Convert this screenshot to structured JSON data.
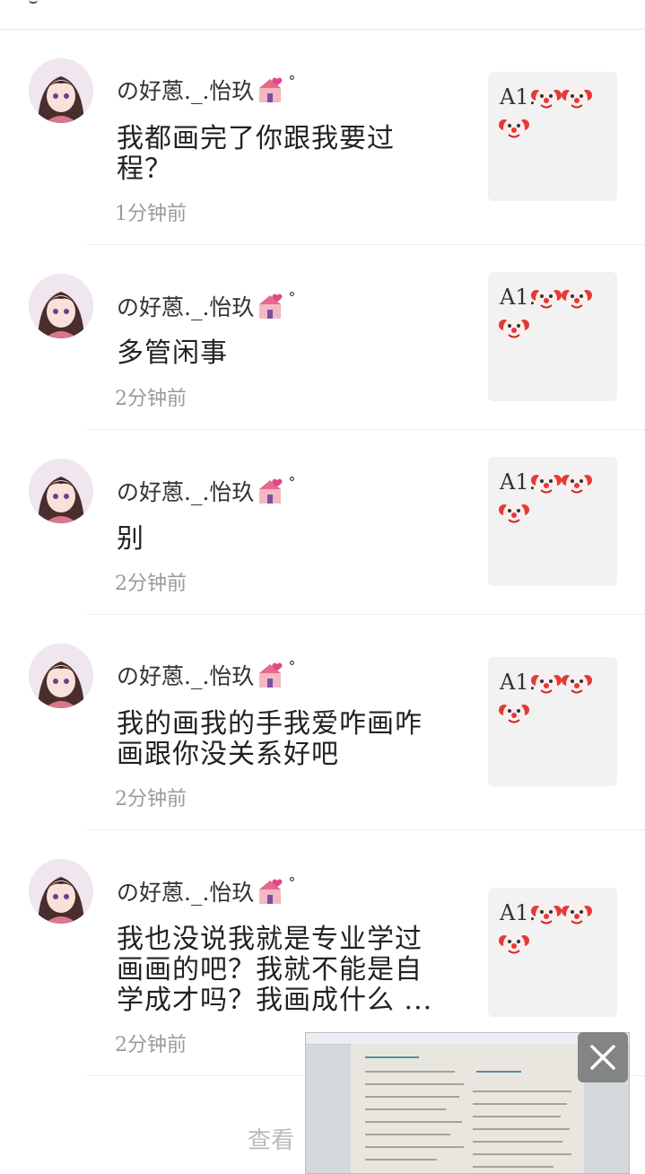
{
  "comments": [
    {
      "user": "の好蒽._.怡玖",
      "text": "我都画完了你跟我要过程？",
      "time": "1分钟前",
      "preview": "A1."
    },
    {
      "user": "の好蒽._.怡玖",
      "text": "多管闲事",
      "time": "2分钟前",
      "preview": "A1."
    },
    {
      "user": "の好蒽._.怡玖",
      "text": "别",
      "time": "2分钟前",
      "preview": "A1."
    },
    {
      "user": "の好蒽._.怡玖",
      "text": "我的画我的手我爱咋画咋画跟你没关系好吧",
      "time": "2分钟前",
      "preview": "A1."
    },
    {
      "user": "の好蒽._.怡玖",
      "text": "我也没说我就是专业学过画画的吧？我就不能是自学成才吗？我画成什么 ...",
      "time": "2分钟前",
      "preview": "A1."
    }
  ],
  "view_more": "查看",
  "icons": {
    "name_badge": "wedding-chapel-hearts-icon",
    "degree": "°",
    "preview_emoji": "clown-face-icon",
    "close": "close-icon"
  }
}
